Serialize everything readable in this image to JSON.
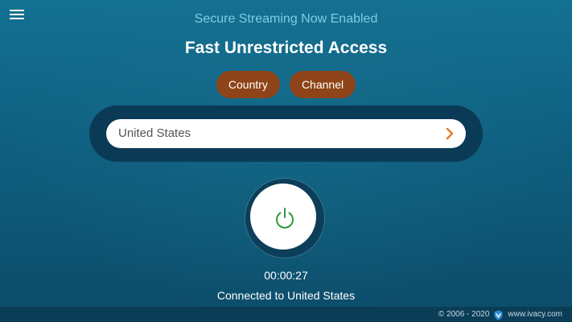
{
  "header": {
    "menu_icon": "hamburger-menu-icon",
    "subtitle": "Secure Streaming Now Enabled",
    "title": "Fast Unrestricted Access"
  },
  "tabs": [
    {
      "label": "Country"
    },
    {
      "label": "Channel"
    }
  ],
  "location": {
    "selected": "United States",
    "icon": "chevron-right-icon"
  },
  "connection": {
    "power_icon": "power-icon",
    "timer": "00:00:27",
    "status": "Connected to United States"
  },
  "footer": {
    "copyright": "© 2006 - 2020",
    "logo_icon": "shield-icon",
    "website": "www.ivacy.com"
  },
  "colors": {
    "background": "#0f5f80",
    "accent": "#8e4418",
    "subtitle": "#7fcbe7",
    "power_green": "#2e9b3c",
    "chevron_orange": "#e07a2c",
    "panel_dark": "#0b3a57"
  }
}
